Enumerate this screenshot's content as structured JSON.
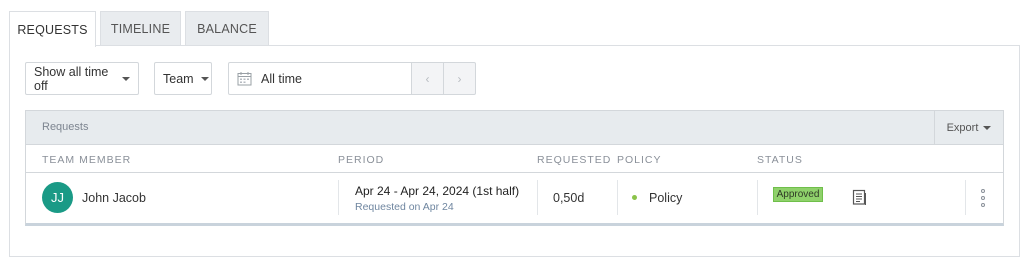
{
  "tabs": [
    {
      "label": "REQUESTS",
      "active": true
    },
    {
      "label": "TIMELINE",
      "active": false
    },
    {
      "label": "BALANCE",
      "active": false
    }
  ],
  "filters": {
    "time_off_type": "Show all time off",
    "team": "Team",
    "date_range": "All time",
    "prev_icon": "chevron-left-icon",
    "next_icon": "chevron-right-icon",
    "calendar_icon": "calendar-icon"
  },
  "table": {
    "title": "Requests",
    "export_label": "Export",
    "columns": {
      "member": "TEAM MEMBER",
      "period": "PERIOD",
      "requested": "REQUESTED",
      "policy": "POLICY",
      "status": "STATUS"
    },
    "rows": [
      {
        "avatar_initials": "JJ",
        "avatar_color": "#1a9a86",
        "member": "John Jacob",
        "period": "Apr 24 - Apr 24, 2024 (1st half)",
        "requested_on": "Requested on Apr 24",
        "requested": "0,50d",
        "policy": "Policy",
        "policy_color": "#8bc34a",
        "status": "Approved",
        "status_color": "#8fd16b"
      }
    ]
  }
}
